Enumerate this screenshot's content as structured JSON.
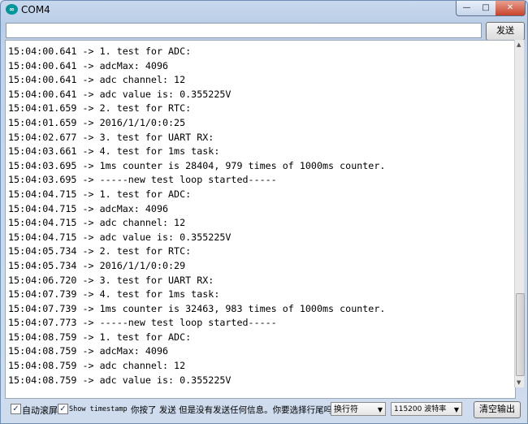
{
  "window": {
    "title": "COM4",
    "app_icon_text": "∞"
  },
  "controls": {
    "minimize": "—",
    "maximize": "□",
    "close": "✕"
  },
  "send": {
    "input_value": "",
    "button_label": "发送"
  },
  "log": {
    "lines": [
      "15:04:00.641 -> 1. test for ADC:",
      "15:04:00.641 -> adcMax: 4096",
      "15:04:00.641 -> adc channel: 12",
      "15:04:00.641 -> adc value is: 0.355225V",
      "15:04:01.659 -> 2. test for RTC:",
      "15:04:01.659 -> 2016/1/1/0:0:25",
      "15:04:02.677 -> 3. test for UART RX:",
      "15:04:03.661 -> 4. test for 1ms task:",
      "15:04:03.695 -> 1ms counter is 28404, 979 times of 1000ms counter.",
      "15:04:03.695 -> -----new test loop started-----",
      "15:04:04.715 -> 1. test for ADC:",
      "15:04:04.715 -> adcMax: 4096",
      "15:04:04.715 -> adc channel: 12",
      "15:04:04.715 -> adc value is: 0.355225V",
      "15:04:05.734 -> 2. test for RTC:",
      "15:04:05.734 -> 2016/1/1/0:0:29",
      "15:04:06.720 -> 3. test for UART RX:",
      "15:04:07.739 -> 4. test for 1ms task:",
      "15:04:07.739 -> 1ms counter is 32463, 983 times of 1000ms counter.",
      "15:04:07.773 -> -----new test loop started-----",
      "15:04:08.759 -> 1. test for ADC:",
      "15:04:08.759 -> adcMax: 4096",
      "15:04:08.759 -> adc channel: 12",
      "15:04:08.759 -> adc value is: 0.355225V"
    ]
  },
  "scrollbar": {
    "up": "▲",
    "down": "▼"
  },
  "footer": {
    "autoscroll": {
      "label": "自动滚屏",
      "checked": true,
      "mark": "✓"
    },
    "timestamp": {
      "label": "Show timestamp",
      "checked": true,
      "mark": "✓"
    },
    "hint": "你按了 发送 但是没有发送任何信息。你要选择行尾吗?",
    "line_ending": {
      "selected": "换行符",
      "arrow": "▼"
    },
    "baud": {
      "selected": "115200 波特率",
      "arrow": "▼"
    },
    "clear_label": "清空输出"
  }
}
